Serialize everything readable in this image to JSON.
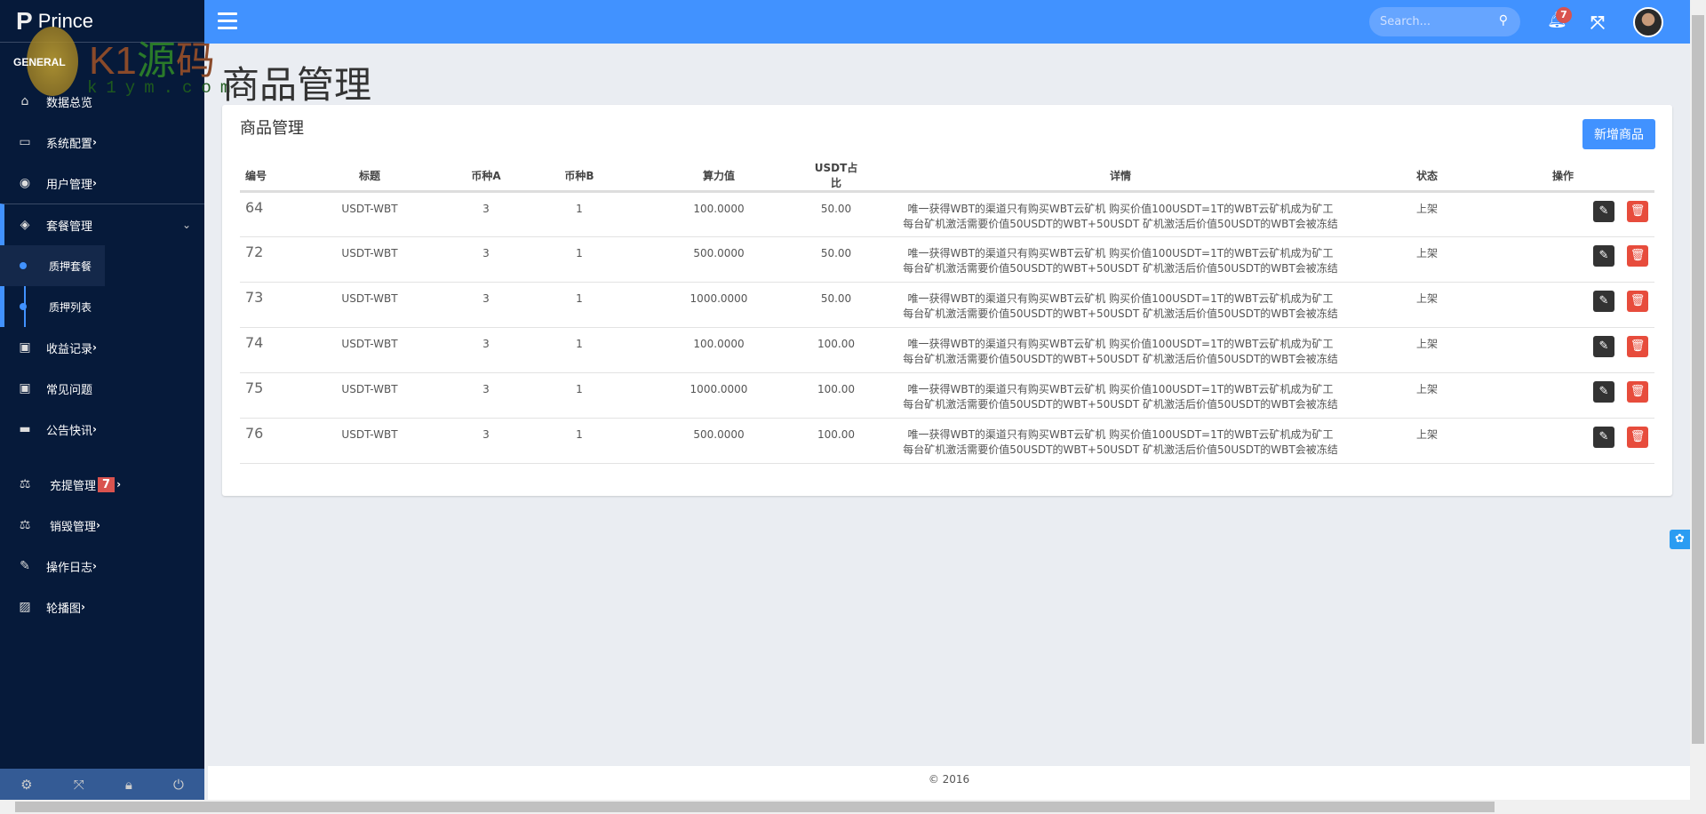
{
  "brand": "Prince",
  "watermark": {
    "text_main": "K1源码",
    "text_url": "k1ym.com"
  },
  "sidebar": {
    "section": "GENERAL",
    "items": [
      {
        "label": "数据总览",
        "icon": "home-icon"
      },
      {
        "label": "系统配置",
        "icon": "monitor-icon"
      },
      {
        "label": "用户管理",
        "icon": "user-circle-icon"
      },
      {
        "label": "套餐管理",
        "icon": "cube-icon"
      },
      {
        "label": "质押套餐"
      },
      {
        "label": "质押列表"
      },
      {
        "label": "收益记录",
        "icon": "money-icon"
      },
      {
        "label": "常见问题",
        "icon": "money-icon"
      },
      {
        "label": "公告快讯",
        "icon": "window-icon"
      },
      {
        "label": "充提管理",
        "icon": "balance-scale-icon",
        "badge": "7"
      },
      {
        "label": "销毁管理",
        "icon": "balance-scale-icon"
      },
      {
        "label": "操作日志",
        "icon": "edit-icon"
      },
      {
        "label": "轮播图",
        "icon": "image-icon"
      }
    ]
  },
  "topbar": {
    "search_placeholder": "Search...",
    "notification_count": "7"
  },
  "page_title": "商品管理",
  "card": {
    "title": "商品管理",
    "add_button": "新增商品"
  },
  "table": {
    "headers": [
      "编号",
      "标题",
      "币种A",
      "币种B",
      "算力值",
      "USDT占比",
      "详情",
      "状态",
      "操作"
    ],
    "rows": [
      {
        "id": "64",
        "title": "USDT-WBT",
        "a": "3",
        "b": "1",
        "power": "100.0000",
        "ratio": "50.00",
        "d1": "唯一获得WBT的渠道只有购买WBT云矿机 购买价值100USDT=1T的WBT云矿机成为矿工",
        "d2": "每台矿机激活需要价值50USDT的WBT+50USDT 矿机激活后价值50USDT的WBT会被冻结",
        "status": "上架"
      },
      {
        "id": "72",
        "title": "USDT-WBT",
        "a": "3",
        "b": "1",
        "power": "500.0000",
        "ratio": "50.00",
        "d1": "唯一获得WBT的渠道只有购买WBT云矿机 购买价值100USDT=1T的WBT云矿机成为矿工",
        "d2": "每台矿机激活需要价值50USDT的WBT+50USDT 矿机激活后价值50USDT的WBT会被冻结",
        "status": "上架"
      },
      {
        "id": "73",
        "title": "USDT-WBT",
        "a": "3",
        "b": "1",
        "power": "1000.0000",
        "ratio": "50.00",
        "d1": "唯一获得WBT的渠道只有购买WBT云矿机 购买价值100USDT=1T的WBT云矿机成为矿工",
        "d2": "每台矿机激活需要价值50USDT的WBT+50USDT 矿机激活后价值50USDT的WBT会被冻结",
        "status": "上架"
      },
      {
        "id": "74",
        "title": "USDT-WBT",
        "a": "3",
        "b": "1",
        "power": "100.0000",
        "ratio": "100.00",
        "d1": "唯一获得WBT的渠道只有购买WBT云矿机 购买价值100USDT=1T的WBT云矿机成为矿工",
        "d2": "每台矿机激活需要价值50USDT的WBT+50USDT 矿机激活后价值50USDT的WBT会被冻结",
        "status": "上架"
      },
      {
        "id": "75",
        "title": "USDT-WBT",
        "a": "3",
        "b": "1",
        "power": "1000.0000",
        "ratio": "100.00",
        "d1": "唯一获得WBT的渠道只有购买WBT云矿机 购买价值100USDT=1T的WBT云矿机成为矿工",
        "d2": "每台矿机激活需要价值50USDT的WBT+50USDT 矿机激活后价值50USDT的WBT会被冻结",
        "status": "上架"
      },
      {
        "id": "76",
        "title": "USDT-WBT",
        "a": "3",
        "b": "1",
        "power": "500.0000",
        "ratio": "100.00",
        "d1": "唯一获得WBT的渠道只有购买WBT云矿机 购买价值100USDT=1T的WBT云矿机成为矿工",
        "d2": "每台矿机激活需要价值50USDT的WBT+50USDT 矿机激活后价值50USDT的WBT会被冻结",
        "status": "上架"
      }
    ]
  },
  "footer": "© 2016",
  "colors": {
    "primary": "#4192ff",
    "sidebar": "#061a3a",
    "danger": "#e74c3c"
  }
}
